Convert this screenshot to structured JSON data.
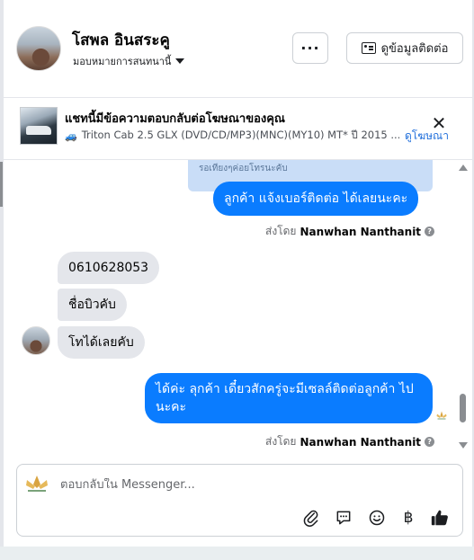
{
  "header": {
    "name": "โสพล อินสระคู",
    "assign_label": "มอบหมายการสนทนานี้",
    "more_label": "···",
    "contact_label": "ดูข้อมูลติดต่อ"
  },
  "ad": {
    "title": "แชทนี้มีข้อความตอบกลับต่อโฆษณาของคุณ",
    "subtitle": "Triton Cab 2.5 GLX (DVD/CD/MP3)(MNC)(MY10) MT* ปี 2015 ...",
    "link": "ดูโฆษณา",
    "close": "✕"
  },
  "messages": {
    "partial_top": "รอเทียงๆค่อยโทรนะคับ",
    "out1": "ลูกค้า แจ้งเบอร์ติดต่อ ได้เลยนะคะ",
    "sent_prefix": "ส่งโดย",
    "sender": "Nanwhan Nanthanit",
    "in1": "0610628053",
    "in2": "ชื่อบิวคับ",
    "in3": "โทได้เลยคับ",
    "out2": "ได้ค่ะ  ลุกค้า   เดี๋ยวสักครู่จะมีเซลล์ติดต่อลูกค้า  ไปนะคะ"
  },
  "composer": {
    "placeholder": "ตอบกลับใน Messenger...",
    "baht": "฿"
  },
  "colors": {
    "outgoing": "#0a7cff",
    "incoming": "#e4e6eb",
    "link": "#216fdb"
  }
}
